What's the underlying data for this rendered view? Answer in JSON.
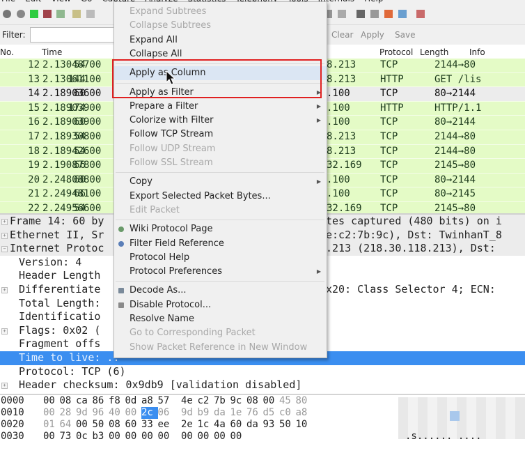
{
  "menubar": [
    "File",
    "Edit",
    "View",
    "Go",
    "Capture",
    "Analyze",
    "Statistics",
    "Telephony",
    "Tools",
    "Internals",
    "Help"
  ],
  "toolbar": {
    "icons": [
      "interfaces-icon",
      "options-icon",
      "start-capture-icon",
      "stop-capture-icon",
      "restart-capture-icon",
      "open-file-icon",
      "save-file-icon",
      "zoom-icon",
      "resize-columns-icon",
      "capture-filters-icon",
      "display-filters-icon",
      "coloring-rules-icon",
      "preferences-icon",
      "help-icon"
    ]
  },
  "filter": {
    "label": "Filter:",
    "value": "",
    "clear": "Clear",
    "apply": "Apply",
    "save": "Save"
  },
  "packet_list": {
    "columns": [
      "No.",
      "Time",
      "Protocol",
      "Length",
      "Info"
    ],
    "rows": [
      {
        "no": "12",
        "time": "2.13048700",
        "dst": "8.213",
        "proto": "TCP",
        "len": "54",
        "info": "2144→80"
      },
      {
        "no": "13",
        "time": "2.13061100",
        "dst": "8.213",
        "proto": "HTTP",
        "len": "144",
        "info": "GET /lis"
      },
      {
        "no": "14",
        "time": "2.18903600",
        "dst": ".100",
        "proto": "TCP",
        "len": "60",
        "info": "80→2144"
      },
      {
        "no": "15",
        "time": "2.18903900",
        "dst": ".100",
        "proto": "HTTP",
        "len": "174",
        "info": "HTTP/1.1"
      },
      {
        "no": "16",
        "time": "2.18903900",
        "dst": ".100",
        "proto": "TCP",
        "len": "60",
        "info": "80→2144"
      },
      {
        "no": "17",
        "time": "2.18930800",
        "dst": "8.213",
        "proto": "TCP",
        "len": "54",
        "info": "2144→80"
      },
      {
        "no": "18",
        "time": "2.18942600",
        "dst": "8.213",
        "proto": "TCP",
        "len": "54",
        "info": "2144→80"
      },
      {
        "no": "19",
        "time": "2.19087800",
        "dst": "32.169",
        "proto": "TCP",
        "len": "66",
        "info": "2145→80"
      },
      {
        "no": "20",
        "time": "2.24808800",
        "dst": ".100",
        "proto": "TCP",
        "len": "60",
        "info": "80→2144"
      },
      {
        "no": "21",
        "time": "2.24948100",
        "dst": ".100",
        "proto": "TCP",
        "len": "66",
        "info": "80→2145"
      },
      {
        "no": "22",
        "time": "2.24956600",
        "dst": "32.169",
        "proto": "TCP",
        "len": "54",
        "info": "2145→80"
      }
    ],
    "selected_no": "14"
  },
  "details": {
    "rows": [
      {
        "exp": "+",
        "left": "Frame 14: 60 by",
        "right": "tes captured (480 bits) on i",
        "hdr": true
      },
      {
        "exp": "+",
        "left": "Ethernet II, Sr",
        "right": "e:c2:7b:9c), Dst: TwinhanT_8",
        "hdr": true
      },
      {
        "exp": "-",
        "left": "Internet Protoc",
        "right": ".213 (218.30.118.213), Dst:",
        "hdr": true
      },
      {
        "exp": "",
        "left": "Version: 4",
        "right": ""
      },
      {
        "exp": "",
        "left": "Header Length",
        "right": ""
      },
      {
        "exp": "+",
        "left": "Differentiate",
        "right": "x20: Class Selector 4; ECN:"
      },
      {
        "exp": "",
        "left": "Total Length:",
        "right": ""
      },
      {
        "exp": "",
        "left": "Identificatio",
        "right": ""
      },
      {
        "exp": "+",
        "left": "Flags: 0x02 (",
        "right": ""
      },
      {
        "exp": "",
        "left": "Fragment offs",
        "right": ""
      },
      {
        "exp": "",
        "left": "Time to live: ..",
        "right": "",
        "sel": true
      },
      {
        "exp": "",
        "left": "Protocol: TCP (6)",
        "right": ""
      },
      {
        "exp": "+",
        "left": "Header checksum: 0x9db9 [validation disabled]",
        "right": ""
      }
    ]
  },
  "bytes": {
    "rows": [
      {
        "off": "0000",
        "hex": [
          "00",
          "08",
          "ca",
          "86",
          "f8",
          "0d",
          "a8",
          "57",
          "4e",
          "c2",
          "7b",
          "9c",
          "08",
          "00",
          "45",
          "80"
        ],
        "dim": [
          14,
          15
        ],
        "hl": []
      },
      {
        "off": "0010",
        "hex": [
          "00",
          "28",
          "9d",
          "96",
          "40",
          "00",
          "2c",
          "06",
          "9d",
          "b9",
          "da",
          "1e",
          "76",
          "d5",
          "c0",
          "a8"
        ],
        "dim": [
          0,
          1,
          2,
          3,
          4,
          5,
          7,
          8,
          9,
          10,
          11,
          12,
          13,
          14,
          15
        ],
        "hl": [
          6
        ]
      },
      {
        "off": "0020",
        "hex": [
          "01",
          "64",
          "00",
          "50",
          "08",
          "60",
          "33",
          "ee",
          "2e",
          "1c",
          "4a",
          "60",
          "da",
          "93",
          "50",
          "10"
        ],
        "dim": [
          0,
          1
        ],
        "hl": []
      },
      {
        "off": "0030",
        "hex": [
          "00",
          "73",
          "0c",
          "b3",
          "00",
          "00",
          "00",
          "00",
          "00",
          "00",
          "00",
          "00"
        ],
        "dim": [],
        "hl": []
      }
    ],
    "ascii_last": ".s...... ...."
  },
  "context_menu": {
    "items": [
      {
        "label": "Expand Subtrees",
        "disabled": true
      },
      {
        "label": "Collapse Subtrees",
        "disabled": true
      },
      {
        "label": "Expand All"
      },
      {
        "label": "Collapse All"
      },
      {
        "sep": true
      },
      {
        "label": "Apply as Column",
        "hover": true
      },
      {
        "sep": true
      },
      {
        "label": "Apply as Filter",
        "submenu": true
      },
      {
        "label": "Prepare a Filter",
        "submenu": true
      },
      {
        "label": "Colorize with Filter",
        "submenu": true
      },
      {
        "label": "Follow TCP Stream"
      },
      {
        "label": "Follow UDP Stream",
        "disabled": true
      },
      {
        "label": "Follow SSL Stream",
        "disabled": true
      },
      {
        "sep": true
      },
      {
        "label": "Copy",
        "submenu": true
      },
      {
        "label": "Export Selected Packet Bytes..."
      },
      {
        "label": "Edit Packet",
        "disabled": true
      },
      {
        "sep": true
      },
      {
        "label": "Wiki Protocol Page",
        "icon": "wiki-icon"
      },
      {
        "label": "Filter Field Reference",
        "icon": "globe-icon"
      },
      {
        "label": "Protocol Help"
      },
      {
        "label": "Protocol Preferences",
        "submenu": true
      },
      {
        "sep": true
      },
      {
        "label": "Decode As...",
        "icon": "decode-icon"
      },
      {
        "label": "Disable Protocol...",
        "icon": "check-icon"
      },
      {
        "label": "Resolve Name"
      },
      {
        "label": "Go to Corresponding Packet",
        "disabled": true
      },
      {
        "label": "Show Packet Reference in New Window",
        "disabled": true
      }
    ]
  },
  "colors": {
    "row_green": "#e4fbc6",
    "selection_blue": "#3b8ef0",
    "highlight_box": "#e02020"
  }
}
